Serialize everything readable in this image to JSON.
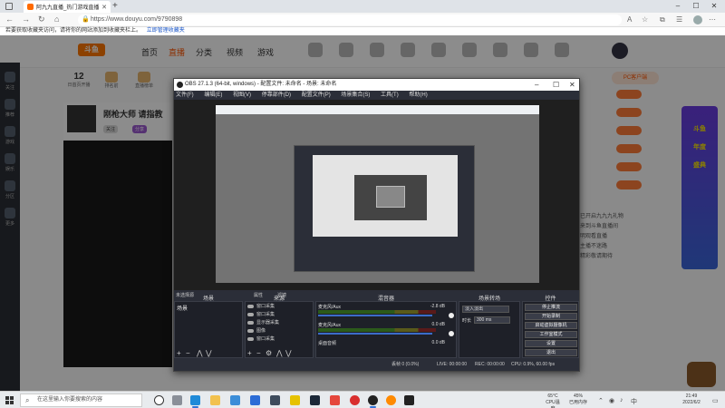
{
  "browser": {
    "tab_title": "阿九九直播_热门游戏直播_从斗鱼开始",
    "url": "https://www.douyu.com/9790898",
    "info_bar_text": "若要获取收藏夹访问，请将你的网站添加到收藏夹栏上。",
    "info_bar_link": "立即管理收藏夹"
  },
  "site": {
    "logo": "斗鱼",
    "nav": [
      "首页",
      "直播",
      "分类",
      "视频",
      "游戏"
    ],
    "nav_active_index": 1,
    "rail_items": [
      "关注",
      "推荐",
      "游戏",
      "娱乐",
      "分区",
      "更多"
    ],
    "stat_value": "12",
    "stats_labels": [
      "日首页开播",
      "排名前",
      "直播榜单"
    ],
    "room_title": "刚枪大师 请指教",
    "room_tags": [
      "关注",
      "分享"
    ],
    "pc_button": "PC客户端",
    "announcement": [
      "主播已开启九九九礼物",
      "欢迎来到斗鱼直播间",
      "请文明观看直播",
      "关注主播不迷路",
      "更多精彩敬请期待"
    ],
    "poster_text": [
      "斗鱼",
      "年度",
      "盛典"
    ]
  },
  "obs": {
    "title": "OBS 27.1.3 (64-bit, windows) - 配置文件: 未命名 - 场景: 未命名",
    "menu": [
      "文件(F)",
      "编辑(E)",
      "视图(V)",
      "停靠部件(D)",
      "配置文件(P)",
      "场景集合(S)",
      "工具(T)",
      "帮助(H)"
    ],
    "scene_selector_label": "未选择源",
    "chips": [
      "属性",
      "滤镜"
    ],
    "docks": {
      "scenes": "场景",
      "sources": "来源",
      "mixer": "混音器",
      "transitions": "场景转场",
      "controls": "控件"
    },
    "scene_name": "场景",
    "sources": [
      "窗口采集",
      "窗口采集",
      "显示器采集",
      "图像",
      "窗口采集"
    ],
    "mixer_tracks": [
      {
        "name": "麦克风/Aux",
        "db": "-2.8 dB"
      },
      {
        "name": "麦克风/Aux",
        "db": "0.0 dB"
      },
      {
        "name": "桌面音频",
        "db": "0.0 dB"
      }
    ],
    "transition_value": "淡入淡出",
    "duration_label": "时长",
    "duration_value": "300 ms",
    "controls": [
      "停止推流",
      "开始录制",
      "启动虚拟摄像机",
      "工作室模式",
      "设置",
      "退出"
    ],
    "status": {
      "live": "LIVE: 00:00:00",
      "rec": "REC: 00:00:00",
      "cpu": "CPU: 0.9%, 60.00 fps",
      "dropped": "丢帧 0 (0.0%)"
    }
  },
  "taskbar": {
    "search_placeholder": "在这里输入你要搜索的内容",
    "weather_temp": "65°C",
    "weather_label": "CPU温度",
    "cpu_pct": "45%",
    "cpu_label": "已用内存",
    "time": "21:49",
    "date": "2022/6/2"
  },
  "colors": {
    "brand": "#ff7700",
    "obs_bg": "#2b2e38",
    "accent": "#3173d6"
  }
}
